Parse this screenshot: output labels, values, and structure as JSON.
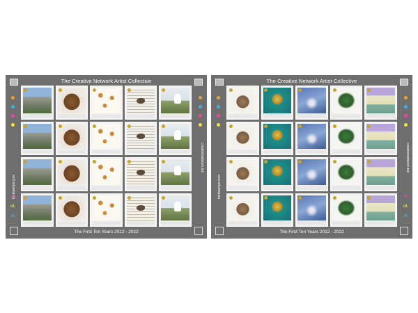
{
  "sheets": [
    {
      "title": "The Creative Network Artist Collective",
      "footer": "The First Ten Years  2012 - 2022",
      "left_url": "lomtsamps.com",
      "right_url": "creativenetwork.biz",
      "stamps": [
        "rock",
        "bowl",
        "dots",
        "bird",
        "field"
      ]
    },
    {
      "title": "The Creative Network Artist Collective",
      "footer": "The First Ten Years  2012 - 2022",
      "left_url": "lomtsamps.com",
      "right_url": "creativenetwork.biz",
      "stamps": [
        "rhino",
        "orb",
        "flower",
        "leaf",
        "house"
      ]
    }
  ],
  "colors": {
    "sheet_bg": "#6e6e6e",
    "registration_dots": [
      "#e8a33a",
      "#35b6e6",
      "#e84aa0",
      "#f2e23a"
    ],
    "marks": [
      "#e84aa0",
      "#f2e23a",
      "#35b6e6"
    ]
  },
  "icons": [
    "logo-icon",
    "corner-mark-icon"
  ]
}
